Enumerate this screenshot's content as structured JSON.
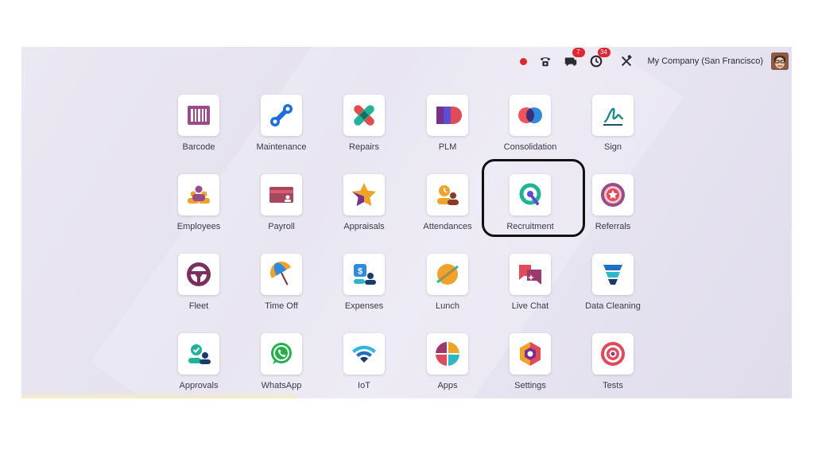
{
  "topbar": {
    "messages_badge": "7",
    "activities_badge": "34",
    "company": "My Company (San Francisco)"
  },
  "apps": [
    {
      "label": "Barcode",
      "icon": "barcode-icon"
    },
    {
      "label": "Maintenance",
      "icon": "maintenance-icon"
    },
    {
      "label": "Repairs",
      "icon": "repairs-icon"
    },
    {
      "label": "PLM",
      "icon": "plm-icon"
    },
    {
      "label": "Consolidation",
      "icon": "consolidation-icon"
    },
    {
      "label": "Sign",
      "icon": "sign-icon"
    },
    {
      "label": "Employees",
      "icon": "employees-icon"
    },
    {
      "label": "Payroll",
      "icon": "payroll-icon"
    },
    {
      "label": "Appraisals",
      "icon": "appraisals-icon"
    },
    {
      "label": "Attendances",
      "icon": "attendances-icon"
    },
    {
      "label": "Recruitment",
      "icon": "recruitment-icon"
    },
    {
      "label": "Referrals",
      "icon": "referrals-icon"
    },
    {
      "label": "Fleet",
      "icon": "fleet-icon"
    },
    {
      "label": "Time Off",
      "icon": "time-off-icon"
    },
    {
      "label": "Expenses",
      "icon": "expenses-icon"
    },
    {
      "label": "Lunch",
      "icon": "lunch-icon"
    },
    {
      "label": "Live Chat",
      "icon": "live-chat-icon"
    },
    {
      "label": "Data Cleaning",
      "icon": "data-cleaning-icon"
    },
    {
      "label": "Approvals",
      "icon": "approvals-icon"
    },
    {
      "label": "WhatsApp",
      "icon": "whatsapp-icon"
    },
    {
      "label": "IoT",
      "icon": "iot-icon"
    },
    {
      "label": "Apps",
      "icon": "apps-icon"
    },
    {
      "label": "Settings",
      "icon": "settings-icon"
    },
    {
      "label": "Tests",
      "icon": "tests-icon"
    }
  ],
  "colors": {
    "badge": "#e0262f",
    "highlight_border": "#111111"
  }
}
